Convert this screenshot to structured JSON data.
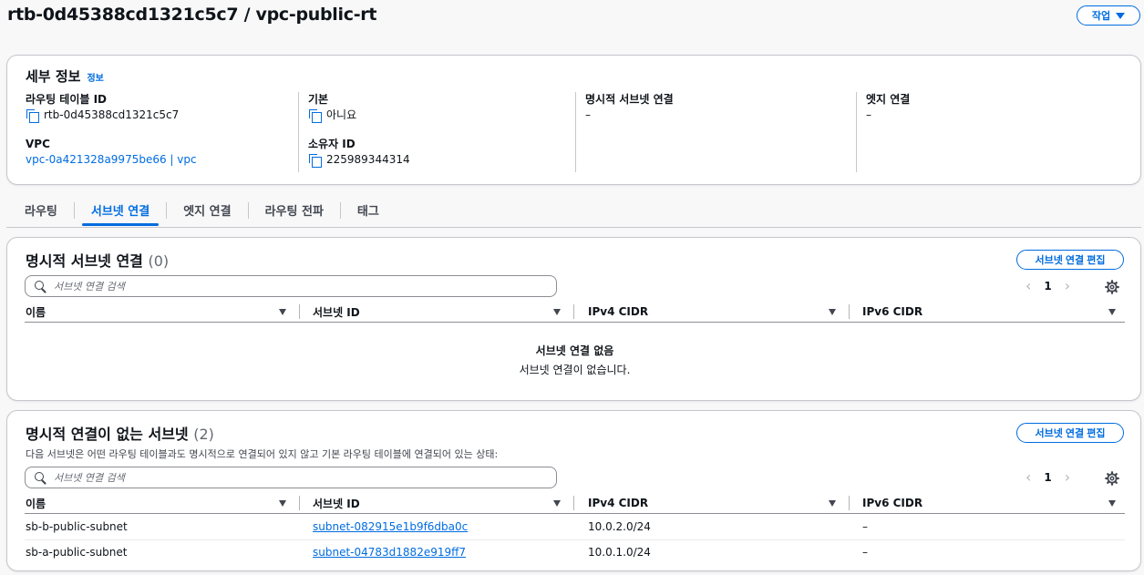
{
  "page": {
    "title": "rtb-0d45388cd1321c5c7 / vpc-public-rt",
    "actions_label": "작업"
  },
  "details": {
    "heading": "세부 정보",
    "info_link": "정보",
    "route_table_id_label": "라우팅 테이블 ID",
    "route_table_id": "rtb-0d45388cd1321c5c7",
    "vpc_label": "VPC",
    "vpc_value": "vpc-0a421328a9975be66 | vpc",
    "main_label": "기본",
    "main_value": "아니요",
    "owner_label": "소유자 ID",
    "owner_value": "225989344314",
    "explicit_label": "명시적 서브넷 연결",
    "explicit_value": "–",
    "edge_label": "엣지 연결",
    "edge_value": "–"
  },
  "tabs": [
    "라우팅",
    "서브넷 연결",
    "엣지 연결",
    "라우팅 전파",
    "태그"
  ],
  "active_tab": "서브넷 연결",
  "explicit_panel": {
    "title": "명시적 서브넷 연결",
    "count": "(0)",
    "edit_label": "서브넷 연결 편집",
    "search_placeholder": "서브넷 연결 검색",
    "page": "1",
    "columns": [
      "이름",
      "서브넷 ID",
      "IPv4 CIDR",
      "IPv6 CIDR"
    ],
    "empty_title": "서브넷 연결 없음",
    "empty_text": "서브넷 연결이 없습니다."
  },
  "implicit_panel": {
    "title": "명시적 연결이 없는 서브넷",
    "count": "(2)",
    "subtitle": "다음 서브넷은 어떤 라우팅 테이블과도 명시적으로 연결되어 있지 않고 기본 라우팅 테이블에 연결되어 있는 상태:",
    "edit_label": "서브넷 연결 편집",
    "search_placeholder": "서브넷 연결 검색",
    "page": "1",
    "columns": [
      "이름",
      "서브넷 ID",
      "IPv4 CIDR",
      "IPv6 CIDR"
    ],
    "rows": [
      {
        "name": "sb-b-public-subnet",
        "subnet_id": "subnet-082915e1b9f6dba0c",
        "ipv4": "10.0.2.0/24",
        "ipv6": "–"
      },
      {
        "name": "sb-a-public-subnet",
        "subnet_id": "subnet-04783d1882e919ff7",
        "ipv4": "10.0.1.0/24",
        "ipv6": "–"
      }
    ]
  },
  "colors": {
    "accent": "#006ce0",
    "text": "#0f141a",
    "border": "#c6c6cd"
  }
}
